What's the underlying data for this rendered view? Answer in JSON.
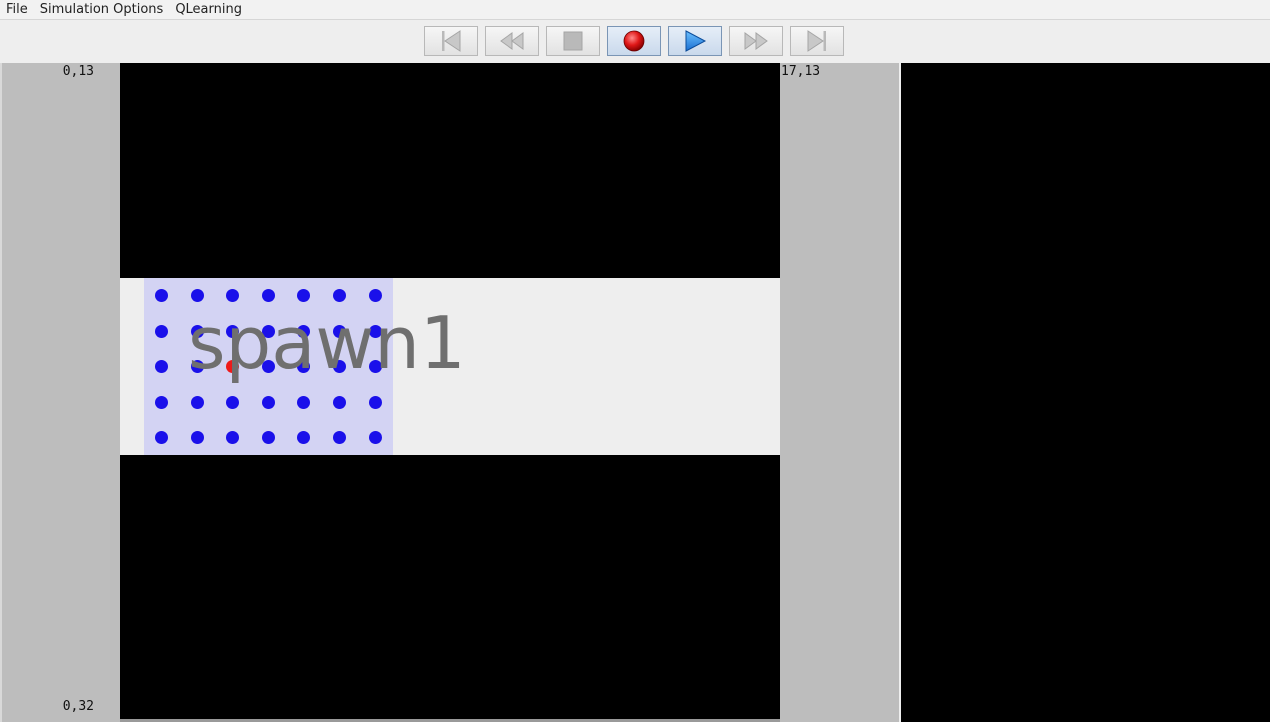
{
  "menu": {
    "items": [
      "File",
      "Simulation Options",
      "QLearning"
    ]
  },
  "toolbar": {
    "buttons": [
      {
        "name": "skip-to-start",
        "icon": "skip-start-icon",
        "active": false
      },
      {
        "name": "rewind",
        "icon": "rewind-icon",
        "active": false
      },
      {
        "name": "stop",
        "icon": "stop-icon",
        "active": false
      },
      {
        "name": "record",
        "icon": "record-icon",
        "active": true
      },
      {
        "name": "play",
        "icon": "play-icon",
        "active": true
      },
      {
        "name": "fast-forward",
        "icon": "fast-forward-icon",
        "active": false
      },
      {
        "name": "skip-to-end",
        "icon": "skip-end-icon",
        "active": false
      }
    ]
  },
  "grid": {
    "top_left_coord": "0,13",
    "top_right_coord": "17,13",
    "bottom_left_coord": "0,32"
  },
  "spawn": {
    "label": "spawn1",
    "rows": 5,
    "cols": 7,
    "highlighted_agent": {
      "row": 2,
      "col": 2
    }
  },
  "colors": {
    "agent": "#1a10ea",
    "highlighted_agent": "#ee1a1a",
    "spawn_area": "#d3d3f3",
    "obstacle": "#000000",
    "walkable": "#eeeeee"
  }
}
